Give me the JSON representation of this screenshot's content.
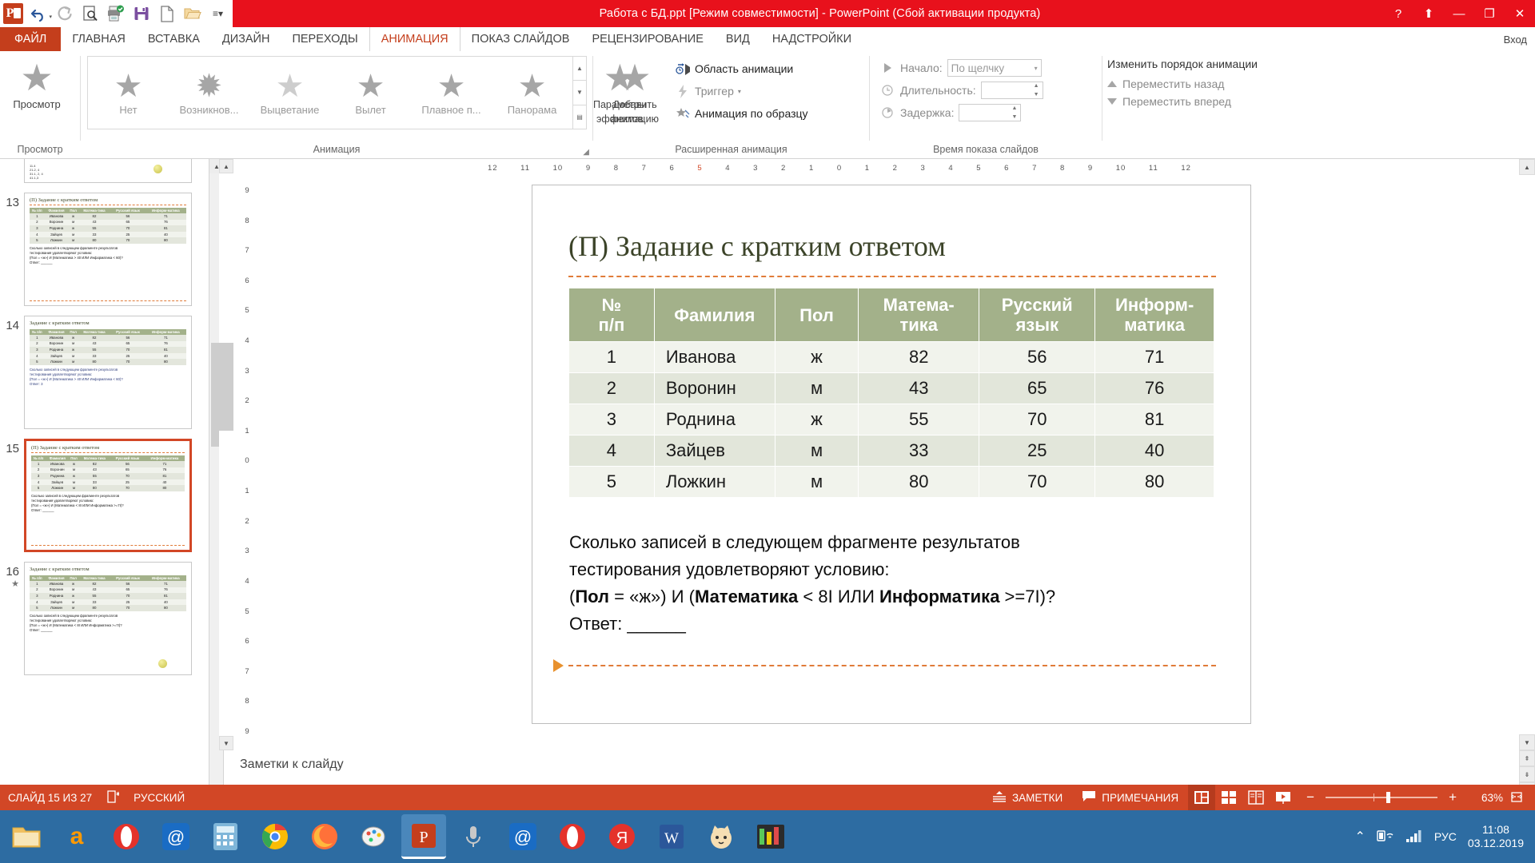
{
  "titlebar": {
    "title": "Работа с БД.ppt [Режим совместимости]  -  PowerPoint (Сбой активации продукта)",
    "quick_access": [
      "powerpoint-logo",
      "undo-icon",
      "redo-icon",
      "preview-icon",
      "print-icon",
      "save-icon",
      "new-icon",
      "open-icon",
      "customize-icon"
    ],
    "help": "?",
    "ribbon_display": "⬆",
    "minimize": "—",
    "restore": "❐",
    "close": "✕"
  },
  "tabs": {
    "file": "ФАЙЛ",
    "items": [
      "ГЛАВНАЯ",
      "ВСТАВКА",
      "ДИЗАЙН",
      "ПЕРЕХОДЫ",
      "АНИМАЦИЯ",
      "ПОКАЗ СЛАЙДОВ",
      "РЕЦЕНЗИРОВАНИЕ",
      "ВИД",
      "НАДСТРОЙКИ"
    ],
    "active": "АНИМАЦИЯ",
    "login": "Вход"
  },
  "ribbon": {
    "preview": {
      "label": "Просмотр",
      "group": "Просмотр"
    },
    "animation_group": {
      "label": "Анимация",
      "gallery": [
        "Нет",
        "Возникнов...",
        "Выцветание",
        "Вылет",
        "Плавное п...",
        "Панорама"
      ],
      "effect_options_line1": "Параметры",
      "effect_options_line2": "эффектов"
    },
    "advanced_group": {
      "label": "Расширенная анимация",
      "add_animation_line1": "Добавить",
      "add_animation_line2": "анимацию",
      "animation_pane": "Область анимации",
      "trigger": "Триггер",
      "animation_painter": "Анимация по образцу"
    },
    "timing_group": {
      "label": "Время показа слайдов",
      "start_label": "Начало:",
      "start_value": "По щелчку",
      "duration_label": "Длительность:",
      "duration_value": "",
      "delay_label": "Задержка:",
      "delay_value": "",
      "reorder_title": "Изменить порядок анимации",
      "move_earlier": "Переместить назад",
      "move_later": "Переместить вперед"
    }
  },
  "ruler": {
    "horizontal": [
      "12",
      "11",
      "10",
      "9",
      "8",
      "7",
      "6",
      "5",
      "4",
      "3",
      "2",
      "1",
      "0",
      "1",
      "2",
      "3",
      "4",
      "5",
      "6",
      "7",
      "8",
      "9",
      "10",
      "11",
      "12"
    ],
    "vertical": [
      "9",
      "8",
      "7",
      "6",
      "5",
      "4",
      "3",
      "2",
      "1",
      "0",
      "1",
      "2",
      "3",
      "4",
      "5",
      "6",
      "7",
      "8",
      "9"
    ]
  },
  "slide": {
    "title": "(П) Задание с кратким ответом",
    "table": {
      "headers": [
        "№\nп/п",
        "Фамилия",
        "Пол",
        "Матема-\nтика",
        "Русский\nязык",
        "Информ-\nматика"
      ],
      "header_cells": [
        {
          "line1": "№",
          "line2": "п/п"
        },
        {
          "line1": "Фамилия",
          "line2": ""
        },
        {
          "line1": "Пол",
          "line2": ""
        },
        {
          "line1": "Матема-",
          "line2": "тика"
        },
        {
          "line1": "Русский",
          "line2": "язык"
        },
        {
          "line1": "Информ-",
          "line2": "матика"
        }
      ],
      "rows": [
        {
          "num": "1",
          "surname": "Иванова",
          "gender": "ж",
          "math": "82",
          "russian": "56",
          "informatics": "71"
        },
        {
          "num": "2",
          "surname": "Воронин",
          "gender": "м",
          "math": "43",
          "russian": "65",
          "informatics": "76"
        },
        {
          "num": "3",
          "surname": "Роднина",
          "gender": "ж",
          "math": "55",
          "russian": "70",
          "informatics": "81"
        },
        {
          "num": "4",
          "surname": "Зайцев",
          "gender": "м",
          "math": "33",
          "russian": "25",
          "informatics": "40"
        },
        {
          "num": "5",
          "surname": "Ложкин",
          "gender": "м",
          "math": "80",
          "russian": "70",
          "informatics": "80"
        }
      ]
    },
    "question_line1": "Сколько записей в следующем фрагменте результатов",
    "question_line2": "тестирования удовлетворяют условию:",
    "condition_prefix": "(",
    "condition_b1": "Пол",
    "condition_mid1": " = «ж») И (",
    "condition_b2": "Математика",
    "condition_mid2": " < 8I  ИЛИ ",
    "condition_b3": "Информатика",
    "condition_suffix": " >=7I)?",
    "answer_label": "Ответ: ______"
  },
  "thumbnails": {
    "notes_placeholder": "Заметки к слайду",
    "slides": [
      {
        "num": "13",
        "title": "(П) Задание с кратким ответом",
        "selected": false
      },
      {
        "num": "14",
        "title": "Задание с кратким ответом",
        "selected": false
      },
      {
        "num": "15",
        "title": "(П) Задание с кратким ответом",
        "selected": true
      },
      {
        "num": "16",
        "title": "Задание с кратким ответом",
        "selected": false
      }
    ],
    "mini_headers": [
      "№ п/п",
      "Фамилия",
      "Пол",
      "Матема-тика",
      "Русский язык",
      "Информ-матика"
    ],
    "mini_rows": [
      [
        "1",
        "Иванова",
        "ж",
        "82",
        "56",
        "71"
      ],
      [
        "2",
        "Воронин",
        "м",
        "43",
        "65",
        "76"
      ],
      [
        "3",
        "Роднина",
        "ж",
        "55",
        "70",
        "81"
      ],
      [
        "4",
        "Зайцев",
        "м",
        "33",
        "25",
        "40"
      ],
      [
        "5",
        "Ложкин",
        "м",
        "80",
        "70",
        "80"
      ]
    ],
    "mini_q1": "Сколько записей в следующем фрагменте результатов",
    "mini_q2": "тестирования удовлетворяют условию:",
    "mini_q3": "(Пол = «ж») И (Математика < 8I ИЛИ Информатика >=7I)?",
    "mini_q3_alt": "(Пол = «ж») И (Математика > 40 ИЛИ Информатика < 60)?",
    "mini_ans": "Ответ: ______",
    "mini_ans_3": "Ответ: 3"
  },
  "statusbar": {
    "slide_counter": "СЛАЙД 15 ИЗ 27",
    "spell_icon": "spellcheck-icon",
    "language": "РУССКИЙ",
    "notes": "ЗАМЕТКИ",
    "comments": "ПРИМЕЧАНИЯ",
    "view_normal": "normal-view-icon",
    "view_sorter": "slide-sorter-icon",
    "view_reading": "reading-view-icon",
    "view_show": "slideshow-icon",
    "zoom_out": "−",
    "zoom_in": "+",
    "zoom_level": "63%",
    "fit_icon": "fit-slide-icon"
  },
  "taskbar": {
    "items": [
      "file-explorer-icon",
      "amazon-icon",
      "opera-icon",
      "mail-at-icon",
      "calculator-icon",
      "chrome-icon",
      "firefox-icon",
      "paint-icon",
      "powerpoint-icon",
      "microphone-icon",
      "mail-at2-icon",
      "opera2-icon",
      "yandex-icon",
      "word-icon",
      "cat-icon",
      "winamp-icon"
    ],
    "tray": {
      "show_hidden": "⌃",
      "network_icon": "network-icon",
      "signal_icon": "signal-icon",
      "lang": "РУС"
    },
    "time": "11:08",
    "date": "03.12.2019"
  },
  "colors": {
    "accent_red": "#e8111c",
    "ribbon_orange": "#c43e1c",
    "table_header_green": "#a3b18a",
    "table_row_odd": "#e2e6da",
    "table_row_even": "#f1f3ec",
    "title_green": "#3c4429",
    "dash_orange": "#e07b39",
    "taskbar_blue": "#2d6ca2",
    "status_orange": "#d24726"
  }
}
